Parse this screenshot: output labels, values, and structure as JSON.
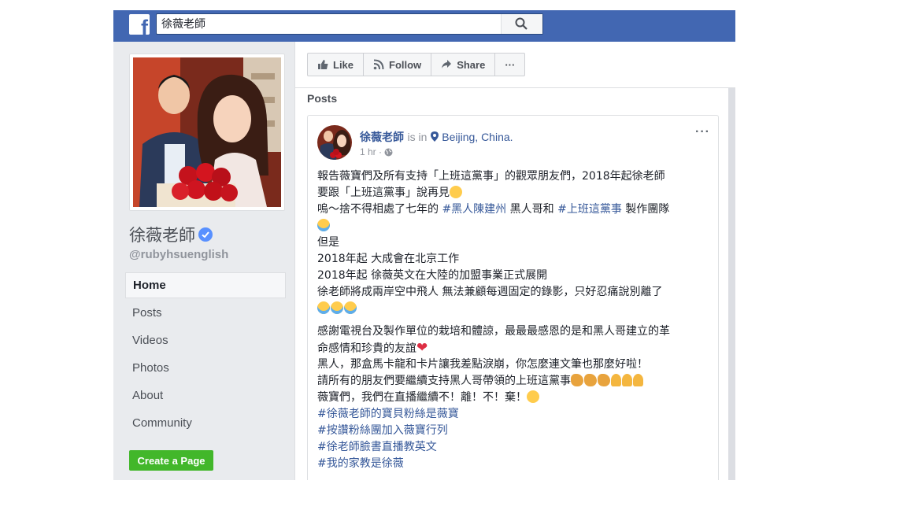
{
  "topbar": {
    "logo": "f",
    "search_value": "徐薇老師",
    "search_icon": "search-icon"
  },
  "page": {
    "name": "徐薇老師",
    "handle": "@rubyhsuenglish",
    "nav": [
      "Home",
      "Posts",
      "Videos",
      "Photos",
      "About",
      "Community"
    ],
    "create_page": "Create a Page"
  },
  "actions": {
    "like": "Like",
    "follow": "Follow",
    "share": "Share",
    "more": "···"
  },
  "posts": {
    "title": "Posts",
    "post": {
      "author": "徐薇老師",
      "is_in": "is in",
      "location": "Beijing, China.",
      "time": "1 hr ·",
      "more": "···",
      "lines": {
        "l1": "報告薇寶們及所有支持「上班這黨事」的觀眾朋友們，2018年起徐老師",
        "l2": "要跟「上班這黨事」說再見",
        "l3a": "嗚～捨不得相處了七年的 ",
        "l3tag1": "#黑人陳建州",
        "l3b": " 黑人哥和 ",
        "l3tag2": "#上班這黨事",
        "l3c": " 製作團隊",
        "l5": "但是",
        "l6": "2018年起 大成會在北京工作",
        "l7": "2018年起 徐薇英文在大陸的加盟事業正式展開",
        "l8": "徐老師將成兩岸空中飛人 無法兼顧每週固定的錄影，只好忍痛說別離了",
        "l10": "感謝電視台及製作單位的栽培和體諒，最最最感恩的是和黑人哥建立的革",
        "l11": "命感情和珍貴的友誼",
        "l12": "黑人，那盒馬卡龍和卡片讓我差點淚崩，你怎麼連文筆也那麼好啦！",
        "l13": "請所有的朋友們要繼續支持黑人哥帶領的上班這黨事",
        "l14": "薇寶們，我們在直播繼續不！離！不！棄！",
        "tag1": "#徐薇老師的寶貝粉絲是薇寶",
        "tag2": "#按讚粉絲團加入薇寶行列",
        "tag3": "#徐老師臉書直播教英文",
        "tag4": "#我的家教是徐薇"
      }
    }
  },
  "colors": {
    "brand": "#4267b2",
    "link": "#365899",
    "create_green": "#42b72a",
    "verified": "#5890ff"
  }
}
